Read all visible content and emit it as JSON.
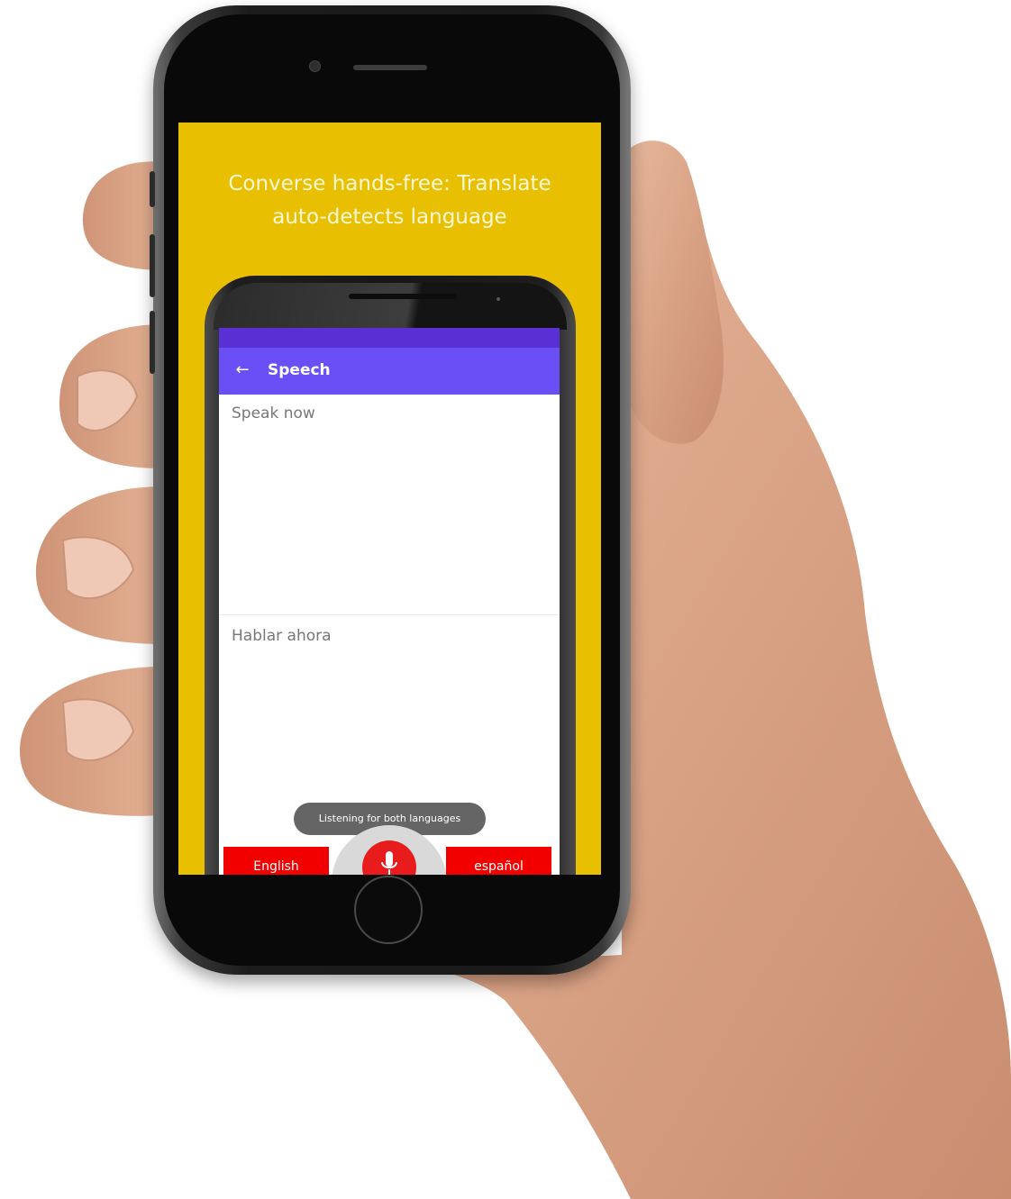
{
  "promo": {
    "headline": "Converse hands-free: Translate\nauto-detects language"
  },
  "app": {
    "toolbar": {
      "back_icon": "arrow-left-icon",
      "title": "Speech"
    },
    "panes": {
      "source_placeholder": "Speak now",
      "target_placeholder": "Hablar ahora"
    },
    "toast": "Listening for both languages",
    "bottom_bar": {
      "left_language": "English",
      "right_language": "español",
      "mic_icon": "microphone-icon"
    }
  },
  "colors": {
    "promo_background": "#e8c001",
    "toolbar": "#6b4ff6",
    "status_bar": "#5a2fd4",
    "language_button": "#f20000",
    "mic_button": "#e81c1c",
    "toast": "#656565"
  }
}
